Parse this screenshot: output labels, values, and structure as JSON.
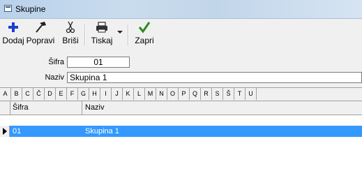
{
  "window": {
    "title": "Skupine"
  },
  "toolbar": {
    "add_label": "Dodaj",
    "edit_label": "Popravi",
    "delete_label": "Briši",
    "print_label": "Tiskaj",
    "close_label": "Zapri",
    "colors": {
      "add": "#1a3fd1",
      "confirm": "#2e8b1e"
    }
  },
  "form": {
    "code_label": "Šifra",
    "code_value": "01",
    "name_label": "Naziv",
    "name_value": "Skupina 1"
  },
  "alphabet": [
    "A",
    "B",
    "C",
    "Č",
    "D",
    "E",
    "F",
    "G",
    "H",
    "I",
    "J",
    "K",
    "L",
    "M",
    "N",
    "O",
    "P",
    "Q",
    "R",
    "S",
    "Š",
    "T",
    "U"
  ],
  "grid": {
    "columns": [
      "Šifra",
      "Naziv"
    ],
    "rows": [
      {
        "code": "01",
        "name": "Skupina 1"
      }
    ],
    "selection_color": "#3399ff"
  }
}
